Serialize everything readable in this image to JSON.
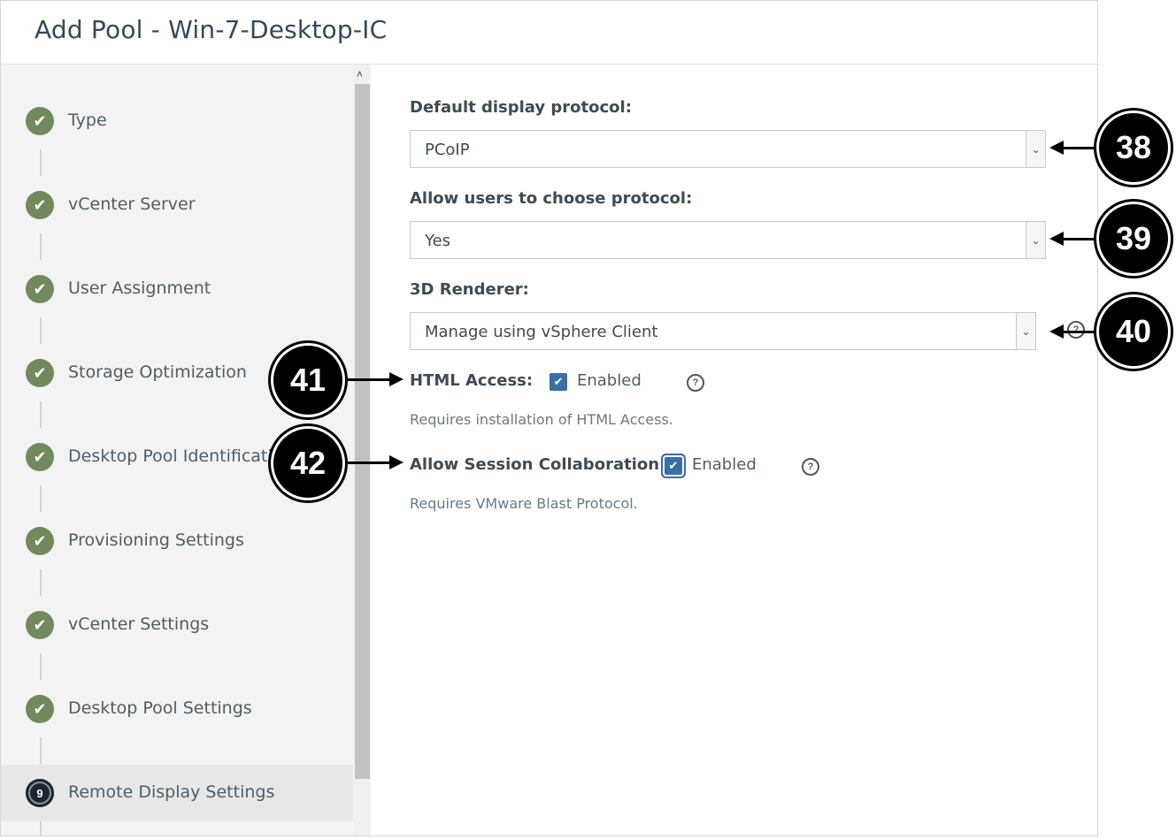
{
  "dialog": {
    "title": "Add Pool - Win-7-Desktop-IC"
  },
  "wizard": {
    "steps": [
      {
        "label": "Type",
        "state": "complete",
        "icon": "check-icon"
      },
      {
        "label": "vCenter Server",
        "state": "complete",
        "icon": "check-icon"
      },
      {
        "label": "User Assignment",
        "state": "complete",
        "icon": "check-icon"
      },
      {
        "label": "Storage Optimization",
        "state": "complete",
        "icon": "check-icon"
      },
      {
        "label": "Desktop Pool Identification",
        "state": "complete",
        "icon": "check-icon"
      },
      {
        "label": "Provisioning Settings",
        "state": "complete",
        "icon": "check-icon"
      },
      {
        "label": "vCenter Settings",
        "state": "complete",
        "icon": "check-icon"
      },
      {
        "label": "Desktop Pool Settings",
        "state": "complete",
        "icon": "check-icon"
      },
      {
        "label": "Remote Display Settings",
        "state": "active",
        "number": "9"
      }
    ]
  },
  "form": {
    "default_protocol": {
      "label": "Default display protocol:",
      "value": "PCoIP"
    },
    "allow_choose": {
      "label": "Allow users to choose protocol:",
      "value": "Yes"
    },
    "renderer": {
      "label": "3D Renderer:",
      "value": "Manage using vSphere Client"
    },
    "html_access": {
      "label": "HTML Access:",
      "checkbox_label": "Enabled",
      "checked": true,
      "hint": "Requires installation of HTML Access."
    },
    "session_collab": {
      "label": "Allow Session Collaboration:",
      "checkbox_label": "Enabled",
      "checked": true,
      "hint": "Requires VMware Blast Protocol."
    }
  },
  "callouts": [
    "38",
    "39",
    "40",
    "41",
    "42"
  ],
  "icons": {
    "check": "✔",
    "chevron_down": "⌄",
    "help": "?",
    "scroll_up": "˄"
  },
  "colors": {
    "step_complete": "#718a5d",
    "step_active": "#1d2530",
    "checkbox": "#3a6fa6",
    "callout": "#000000"
  }
}
